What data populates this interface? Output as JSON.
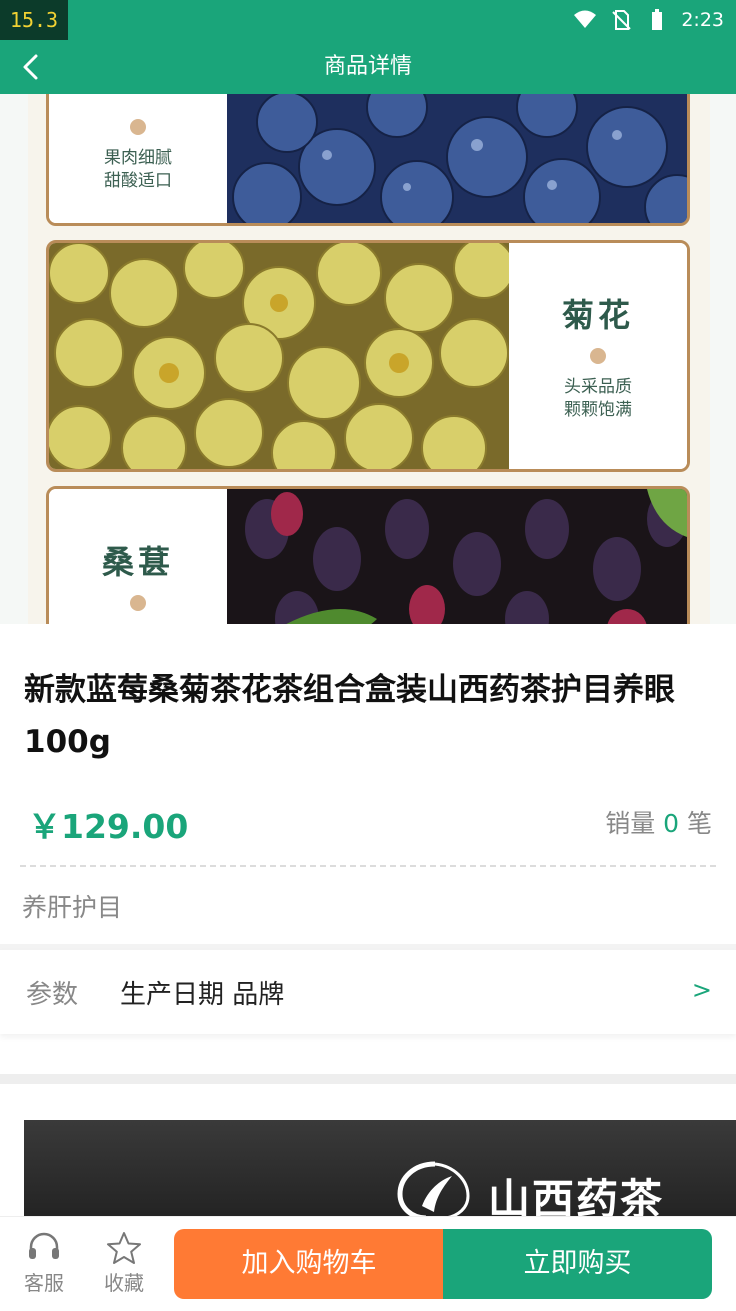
{
  "status_bar": {
    "fps": "15.3",
    "time": "2:23"
  },
  "nav": {
    "title": "商品详情"
  },
  "hero": {
    "cards": [
      {
        "name": "",
        "desc": [
          "果肉细腻",
          "甜酸适口"
        ]
      },
      {
        "name": "菊花",
        "desc": [
          "头采品质",
          "颗颗饱满"
        ]
      },
      {
        "name": "桑葚",
        "desc": []
      }
    ]
  },
  "product": {
    "title": "新款蓝莓桑菊茶花茶组合盒装山西药茶护目养眼100g",
    "price": "￥129.00",
    "sales_prefix": "销量 ",
    "sales_count": "0",
    "sales_suffix": " 笔",
    "tag": "养肝护目"
  },
  "params": {
    "label": "参数",
    "value": "生产日期 品牌",
    "arrow": ">"
  },
  "banner": {
    "brand": "山西药茶"
  },
  "bottom_bar": {
    "service_label": "客服",
    "favorite_label": "收藏",
    "add_cart_label": "加入购物车",
    "buy_now_label": "立即购买"
  },
  "colors": {
    "primary": "#1aa57a",
    "cart": "#ff7a34"
  }
}
